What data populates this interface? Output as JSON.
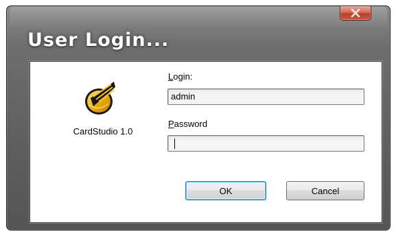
{
  "window": {
    "title": "User Login..."
  },
  "app": {
    "name": "CardStudio 1.0",
    "icon": "cardstudio-logo-icon"
  },
  "login": {
    "label_accel": "L",
    "label_rest": "ogin:",
    "value": "admin"
  },
  "password": {
    "label_accel": "P",
    "label_rest": "assword",
    "value": ""
  },
  "buttons": {
    "ok_label": "OK",
    "cancel_label": "Cancel"
  },
  "icons": {
    "close": "close-icon"
  },
  "colors": {
    "close_button": "#c9563f",
    "default_button_glow": "#48c4ff",
    "logo_gold": "#f0b100"
  }
}
